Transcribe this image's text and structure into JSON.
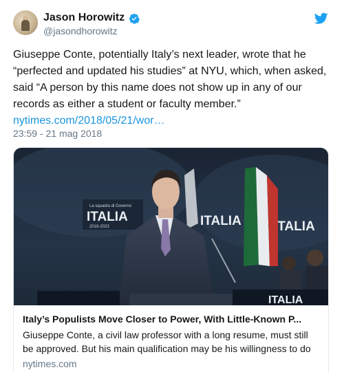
{
  "author": {
    "display_name": "Jason Horowitz",
    "handle": "@jasondhorowitz",
    "verified_icon": "verified-badge-icon",
    "avatar": "avatar-photo"
  },
  "brand": {
    "icon": "twitter-bird-icon",
    "color": "#1da1f2"
  },
  "tweet": {
    "text_lines": [
      "Giuseppe Conte, potentially Italy’s next leader, wrote that he",
      "“perfected and updated his studies” at NYU, which, when asked,",
      "said “A person by this name does not show up in any of our",
      "records as either a student or faculty member.”"
    ],
    "link": "nytimes.com/2018/05/21/wor…",
    "timestamp": "23:59 - 21 mag 2018"
  },
  "card": {
    "image_text": {
      "banner_small": "La squadra di Governo",
      "banner_word": "ITALIA",
      "banner_years": "2018-2023"
    },
    "title": "Italy’s Populists Move Closer to Power, With Little-Known P...",
    "description_lines": [
      "Giuseppe Conte, a civil law professor with a long resume, must still",
      "be approved. But his main qualification may be his willingness to do"
    ],
    "domain": "nytimes.com"
  },
  "colors": {
    "text": "#14171a",
    "secondary": "#657786",
    "link": "#1b95e0",
    "border": "#e1e8ed"
  }
}
